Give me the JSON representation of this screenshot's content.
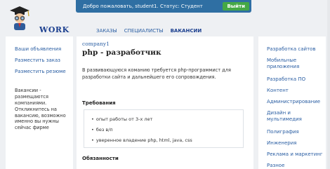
{
  "topbar": {
    "welcome": "Добро пожаловать, student1. Статус: Студент",
    "logout_label": "Выйти"
  },
  "logo": {
    "word": "WORK",
    "icon": "student-with-binoculars-icon"
  },
  "nav": {
    "items": [
      {
        "label": "ЗАКАЗЫ"
      },
      {
        "label": "СПЕЦИАЛИСТЫ"
      },
      {
        "label": "ВАКАНСИИ",
        "active": true
      }
    ]
  },
  "sidebar_left": {
    "links": [
      "Ваши объявления",
      "Разместить заказ",
      "Разместить резюме"
    ],
    "note": "Вакансии - размещаются компаниями. Откликнитесь на вакансию, возможно именно вы нужны сейчас фирме"
  },
  "vacancy": {
    "company": "company1",
    "title": "php - разработчик",
    "description": "В развивающуюся команию требуется php-программист для разработки сайта и дальнейшего его сопровождения.",
    "requirements_title": "Требования",
    "requirements": [
      "опыт работы от 3-х лет",
      "без в/п",
      "уверенное владение php, html, java, css"
    ],
    "duties_title": "Обязанности"
  },
  "sidebar_right": {
    "categories": [
      "Разработка сайтов",
      "Мобильные приложения",
      "Разработка ПО",
      "Контент",
      "Администрирование",
      "Дизайн и мультимедия",
      "Полиграфия",
      "Инженерия",
      "Реклама и маркетинг",
      "Разное"
    ]
  },
  "colors": {
    "topbar": "#2f6fa3",
    "logout": "#45a845",
    "link": "#2a5ea3",
    "page_bg": "#eef0f3"
  }
}
